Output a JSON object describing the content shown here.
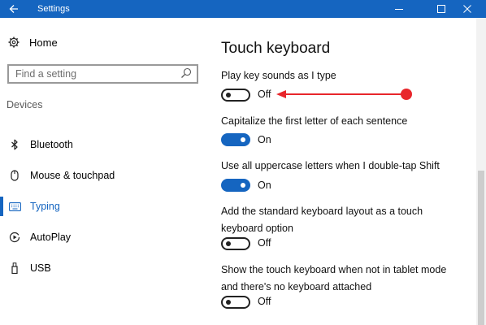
{
  "window": {
    "title": "Settings"
  },
  "sidebar": {
    "home_label": "Home",
    "search": {
      "placeholder": "Find a setting"
    },
    "section_title": "Devices",
    "items": [
      {
        "label": "Bluetooth",
        "icon": "bluetooth-icon"
      },
      {
        "label": "Mouse & touchpad",
        "icon": "mouse-icon"
      },
      {
        "label": "Typing",
        "icon": "keyboard-icon",
        "selected": true
      },
      {
        "label": "AutoPlay",
        "icon": "autoplay-icon"
      },
      {
        "label": "USB",
        "icon": "usb-icon"
      }
    ]
  },
  "main": {
    "title": "Touch keyboard",
    "settings": [
      {
        "label": "Play key sounds as I type",
        "state": "Off"
      },
      {
        "label": "Capitalize the first letter of each sentence",
        "state": "On"
      },
      {
        "label": "Use all uppercase letters when I double-tap Shift",
        "state": "On"
      },
      {
        "label": "Add the standard keyboard layout as a touch keyboard option",
        "state": "Off"
      },
      {
        "label": "Show the touch keyboard when not in tablet mode and there's no keyboard attached",
        "state": "Off"
      }
    ]
  },
  "colors": {
    "accent": "#1565c0",
    "annotation": "#e8262b"
  }
}
